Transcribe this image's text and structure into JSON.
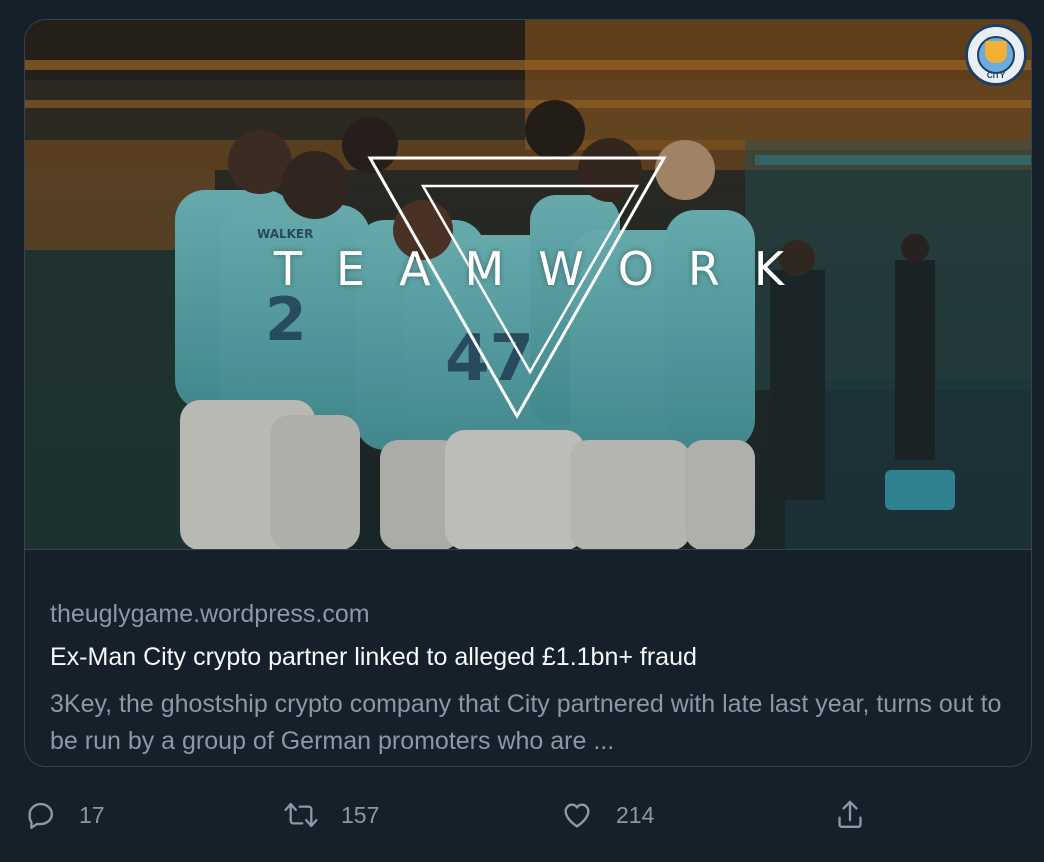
{
  "card": {
    "image": {
      "overlay_word": "TEAMWORK",
      "badge_text": "CITY"
    },
    "domain": "theuglygame.wordpress.com",
    "headline": "Ex-Man City crypto partner linked to alleged £1.1bn+ fraud",
    "description": "3Key, the ghostship crypto company that City partnered with late last year, turns out to be run by a group of German promoters who are ..."
  },
  "actions": {
    "reply": {
      "icon": "reply-icon",
      "count": "17"
    },
    "retweet": {
      "icon": "retweet-icon",
      "count": "157"
    },
    "like": {
      "icon": "heart-icon",
      "count": "214"
    },
    "share": {
      "icon": "share-icon"
    }
  },
  "colors": {
    "background": "#15202b",
    "border": "#38444d",
    "text_primary": "#f7f9f9",
    "text_secondary": "#8b98a5",
    "kit_sky_blue": "#6fc3c9"
  }
}
